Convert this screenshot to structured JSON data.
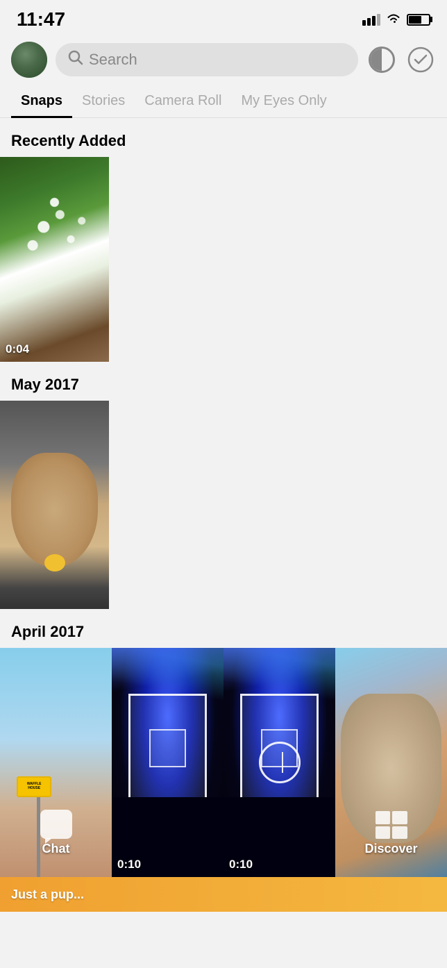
{
  "statusBar": {
    "time": "11:47",
    "signalBars": [
      8,
      11,
      14,
      17
    ],
    "batteryPercent": 65
  },
  "topNav": {
    "searchPlaceholder": "Search",
    "circleIconAlt": "circle-half-icon",
    "checkIconChar": "✓"
  },
  "tabs": [
    {
      "id": "snaps",
      "label": "Snaps",
      "active": true
    },
    {
      "id": "stories",
      "label": "Stories",
      "active": false
    },
    {
      "id": "cameraroll",
      "label": "Camera Roll",
      "active": false
    },
    {
      "id": "myeyesonly",
      "label": "My Eyes Only",
      "active": false
    }
  ],
  "sections": [
    {
      "id": "recently-added",
      "label": "Recently Added",
      "snaps": [
        {
          "id": "snap-1",
          "duration": "0:04",
          "type": "plant"
        }
      ]
    },
    {
      "id": "may-2017",
      "label": "May 2017",
      "snaps": [
        {
          "id": "snap-2",
          "duration": null,
          "type": "dog"
        }
      ]
    },
    {
      "id": "april-2017",
      "label": "April 2017",
      "snaps": [
        {
          "id": "snap-3",
          "duration": null,
          "type": "waffle"
        },
        {
          "id": "snap-4",
          "duration": "0:10",
          "type": "concert1"
        },
        {
          "id": "snap-5",
          "duration": "0:10",
          "type": "concert2"
        },
        {
          "id": "snap-6",
          "duration": null,
          "type": "dog2"
        }
      ]
    }
  ],
  "bottomNav": {
    "chat": {
      "label": "Chat"
    },
    "camera": {
      "label": ""
    },
    "discover": {
      "label": "Discover"
    }
  },
  "justPup": "Just a pup..."
}
